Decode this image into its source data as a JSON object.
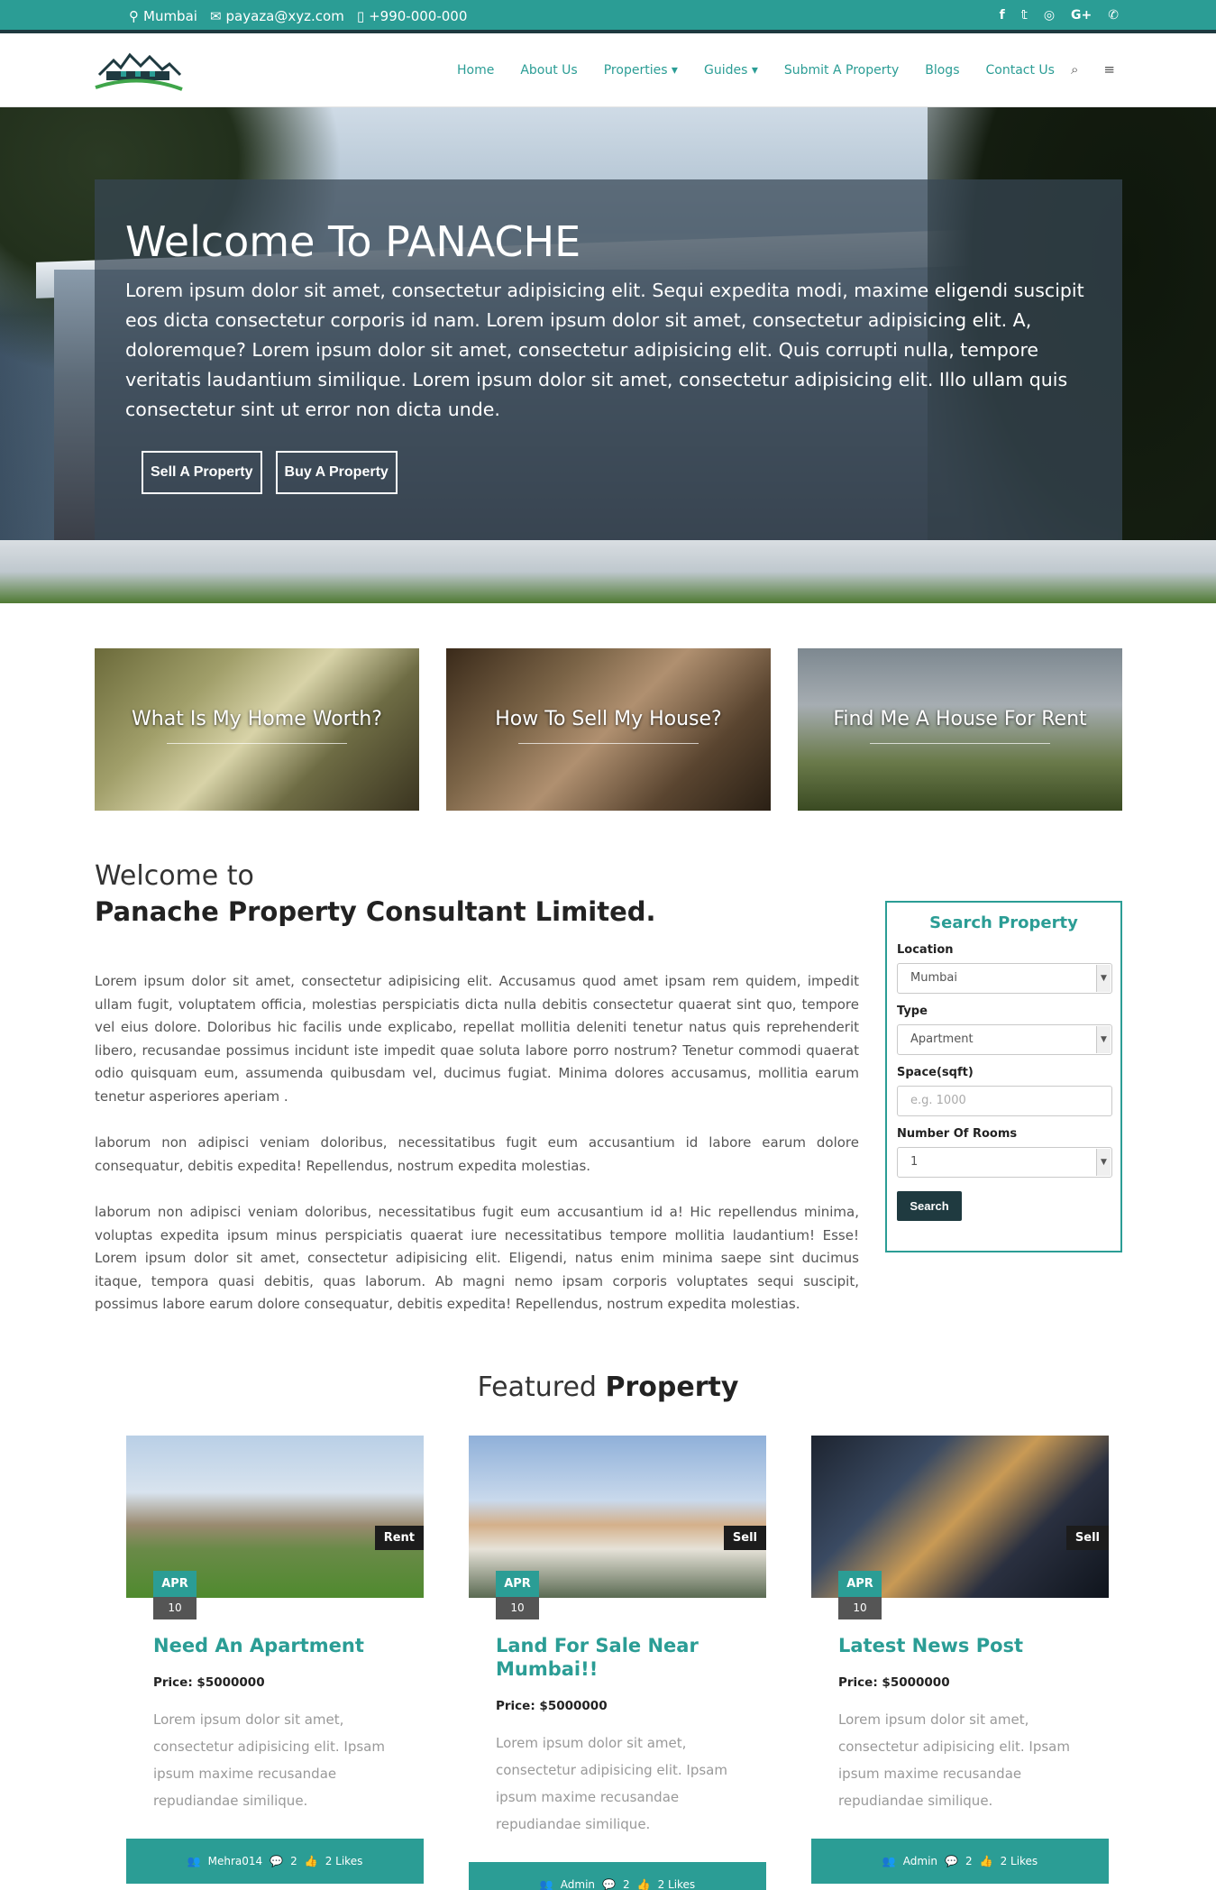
{
  "topbar": {
    "location": "Mumbai",
    "email": "payaza@xyz.com",
    "phone": "+990-000-000",
    "social": [
      "f",
      "t",
      "ig",
      "G+",
      "wa"
    ]
  },
  "nav": {
    "links": [
      "Home",
      "About Us",
      "Properties ▾",
      "Guides ▾",
      "Submit A Property",
      "Blogs",
      "Contact Us"
    ],
    "search_icon": "⌕",
    "menu_icon": "≡"
  },
  "hero": {
    "title": "Welcome To PANACHE",
    "text": "Lorem ipsum dolor sit amet, consectetur adipisicing elit. Sequi expedita modi, maxime eligendi suscipit eos dicta consectetur corporis id nam. Lorem ipsum dolor sit amet, consectetur adipisicing elit. A, doloremque? Lorem ipsum dolor sit amet, consectetur adipisicing elit. Quis corrupti nulla, tempore veritatis laudantium similique. Lorem ipsum dolor sit amet, consectetur adipisicing elit. Illo ullam quis consectetur sint ut error non dicta unde.",
    "sell_label": "Sell A Property",
    "buy_label": "Buy A Property"
  },
  "quick_cards": [
    {
      "title": "What Is My Home Worth?"
    },
    {
      "title": "How To Sell My House?"
    },
    {
      "title": "Find Me A House For Rent"
    }
  ],
  "welcome": {
    "line1": "Welcome to",
    "line2": "Panache Property Consultant Limited.",
    "p1": "Lorem ipsum dolor sit amet, consectetur adipisicing elit. Accusamus quod amet ipsam rem quidem, impedit ullam fugit, voluptatem officia, molestias perspiciatis dicta nulla debitis consectetur quaerat sint quo, tempore vel eius dolore. Doloribus hic facilis unde explicabo, repellat mollitia deleniti tenetur natus quis reprehenderit libero, recusandae possimus incidunt iste impedit quae soluta labore porro nostrum? Tenetur commodi quaerat odio quisquam eum, assumenda quibusdam vel, ducimus fugiat. Minima dolores accusamus, mollitia earum tenetur asperiores aperiam .",
    "p2": "laborum non adipisci veniam doloribus, necessitatibus fugit eum accusantium id labore earum dolore consequatur, debitis expedita! Repellendus, nostrum expedita molestias.",
    "p3": "laborum non adipisci veniam doloribus, necessitatibus fugit eum accusantium id a! Hic repellendus minima, voluptas expedita ipsum minus perspiciatis quaerat iure necessitatibus tempore mollitia laudantium! Esse! Lorem ipsum dolor sit amet, consectetur adipisicing elit. Eligendi, natus enim minima saepe sint ducimus itaque, tempora quasi debitis, quas laborum. Ab magni nemo ipsam corporis voluptates sequi suscipit, possimus labore earum dolore consequatur, debitis expedita! Repellendus, nostrum expedita molestias."
  },
  "search": {
    "title": "Search Property",
    "location_label": "Location",
    "location_value": "Mumbai",
    "type_label": "Type",
    "type_value": "Apartment",
    "space_label": "Space(sqft)",
    "space_placeholder": "e.g. 1000",
    "rooms_label": "Number Of Rooms",
    "rooms_value": "1",
    "button": "Search"
  },
  "featured": {
    "title_light": "Featured ",
    "title_bold": "Property",
    "items": [
      {
        "badge": "Rent",
        "month": "APR",
        "day": "10",
        "title": "Need An Apartment",
        "price": "Price: $5000000",
        "desc": "Lorem ipsum dolor sit amet, consectetur adipisicing elit. Ipsam ipsum maxime recusandae repudiandae similique.",
        "author": "Mehra014",
        "comments": "2",
        "likes": "2 Likes"
      },
      {
        "badge": "Sell",
        "month": "APR",
        "day": "10",
        "title": "Land For Sale Near Mumbai!!",
        "price": "Price: $5000000",
        "desc": "Lorem ipsum dolor sit amet, consectetur adipisicing elit. Ipsam ipsum maxime recusandae repudiandae similique.",
        "author": "Admin",
        "comments": "2",
        "likes": "2 Likes"
      },
      {
        "badge": "Sell",
        "month": "APR",
        "day": "10",
        "title": "Latest News Post",
        "price": "Price: $5000000",
        "desc": "Lorem ipsum dolor sit amet, consectetur adipisicing elit. Ipsam ipsum maxime recusandae repudiandae similique.",
        "author": "Admin",
        "comments": "2",
        "likes": "2 Likes"
      }
    ]
  },
  "colors": {
    "accent": "#2b9d95",
    "dark": "#1f3a40"
  }
}
